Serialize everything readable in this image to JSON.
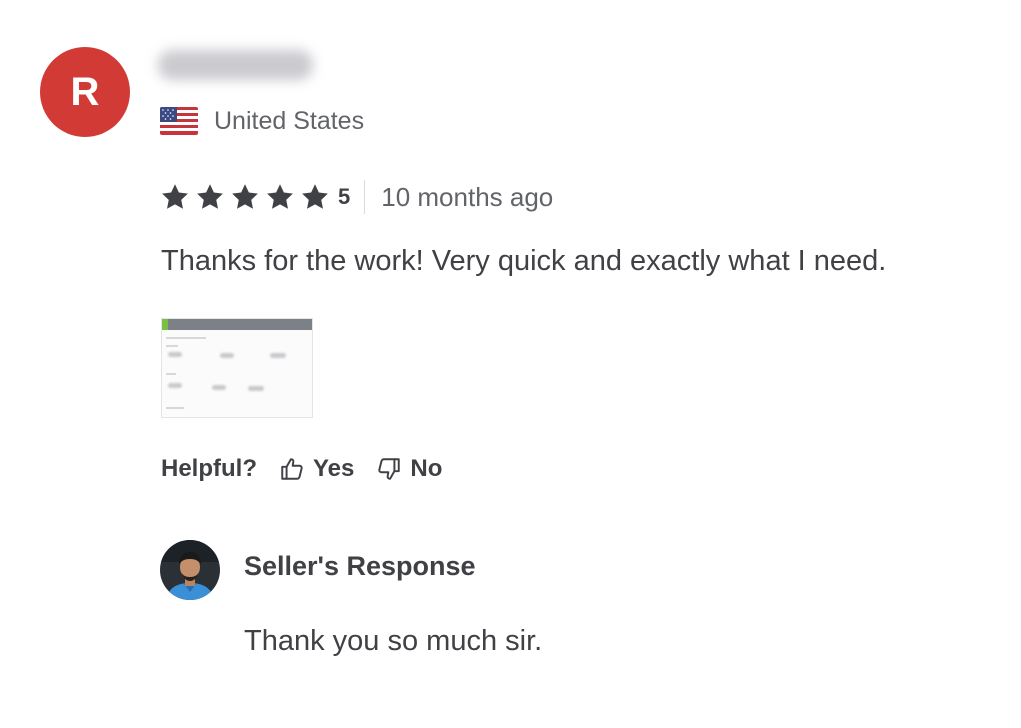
{
  "reviewer": {
    "avatar_initial": "R",
    "avatar_color": "#d23b35",
    "name": "",
    "country": "United States",
    "flag_icon": "us-flag-icon"
  },
  "review": {
    "rating": "5",
    "stars_filled": 5,
    "stars_total": 5,
    "time_ago": "10 months ago",
    "text": "Thanks for the work! Very quick and exactly what I need."
  },
  "helpful": {
    "label": "Helpful?",
    "yes_label": "Yes",
    "no_label": "No",
    "yes_icon": "thumbs-up-icon",
    "no_icon": "thumbs-down-icon"
  },
  "seller_response": {
    "title": "Seller's Response",
    "text": "Thank you so much sir."
  },
  "colors": {
    "text_primary": "#404145",
    "text_secondary": "#62646a",
    "star": "#404145",
    "divider": "#dadbdd"
  }
}
